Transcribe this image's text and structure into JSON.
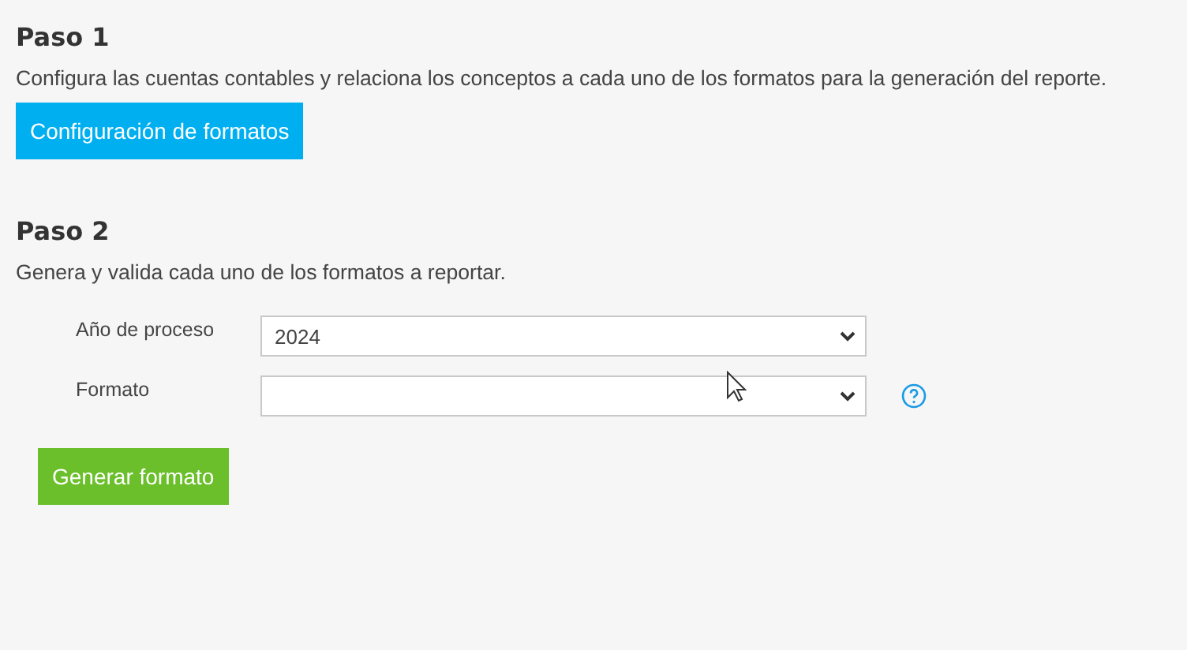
{
  "steps": [
    {
      "title": "Paso 1",
      "description": "Configura las cuentas contables y relaciona los conceptos a cada uno de los formatos para la generación del reporte.",
      "button": {
        "label": "Configuración de formatos",
        "kind": "primary"
      }
    },
    {
      "title": "Paso 2",
      "description": "Genera y valida cada uno de los formatos a reportar.",
      "fields": [
        {
          "label": "Año de proceso",
          "value": "2024"
        },
        {
          "label": "Formato",
          "help": true
        }
      ],
      "button": {
        "label": "Generar formato",
        "kind": "success"
      }
    }
  ]
}
